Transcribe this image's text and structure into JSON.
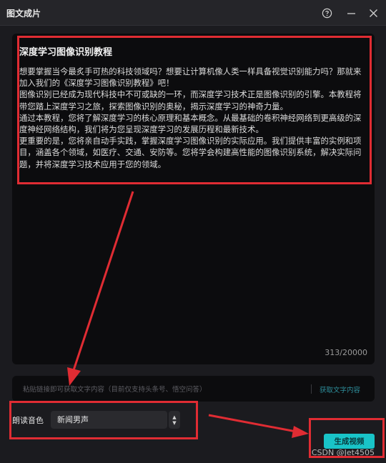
{
  "window": {
    "title": "图文成片",
    "icons": {
      "help": "help-circle-icon",
      "minimize": "minimize-icon",
      "close": "close-icon"
    }
  },
  "editor": {
    "article_title": "深度学习图像识别教程",
    "paragraphs": [
      "想要掌握当今最炙手可热的科技领域吗？想要让计算机像人类一样具备视觉识别能力吗？那就来加入我们的《深度学习图像识别教程》吧！",
      "图像识别已经成为现代科技中不可或缺的一环，而深度学习技术正是图像识别的引擎。本教程将带您踏上深度学习之旅，探索图像识别的奥秘，揭示深度学习的神奇力量。",
      "通过本教程，您将了解深度学习的核心原理和基本概念。从最基础的卷积神经网络到更高级的深度神经网络结构，我们将为您呈现深度学习的发展历程和最新技术。",
      "更重要的是，您将亲自动手实践，掌握深度学习图像识别的实际应用。我们提供丰富的实例和项目，涵盖各个领域，如医疗、交通、安防等。您将学会构建高性能的图像识别系统，解决实际问题，并将深度学习技术应用于您的领域。"
    ],
    "char_count": "313/20000"
  },
  "link_bar": {
    "placeholder": "粘贴链接即可获取文字内容（目前仅支持头条号、悟空问答）",
    "fetch_label": "获取文字内容"
  },
  "voice": {
    "label": "朗读音色",
    "selected": "新闻男声"
  },
  "actions": {
    "generate_label": "生成视频"
  },
  "watermark": "CSDN @Jet4505",
  "colors": {
    "accent": "#19c4c8",
    "annotation": "#e02c33",
    "background": "#1b1b1f",
    "editor_bg": "#0c0c0e"
  }
}
